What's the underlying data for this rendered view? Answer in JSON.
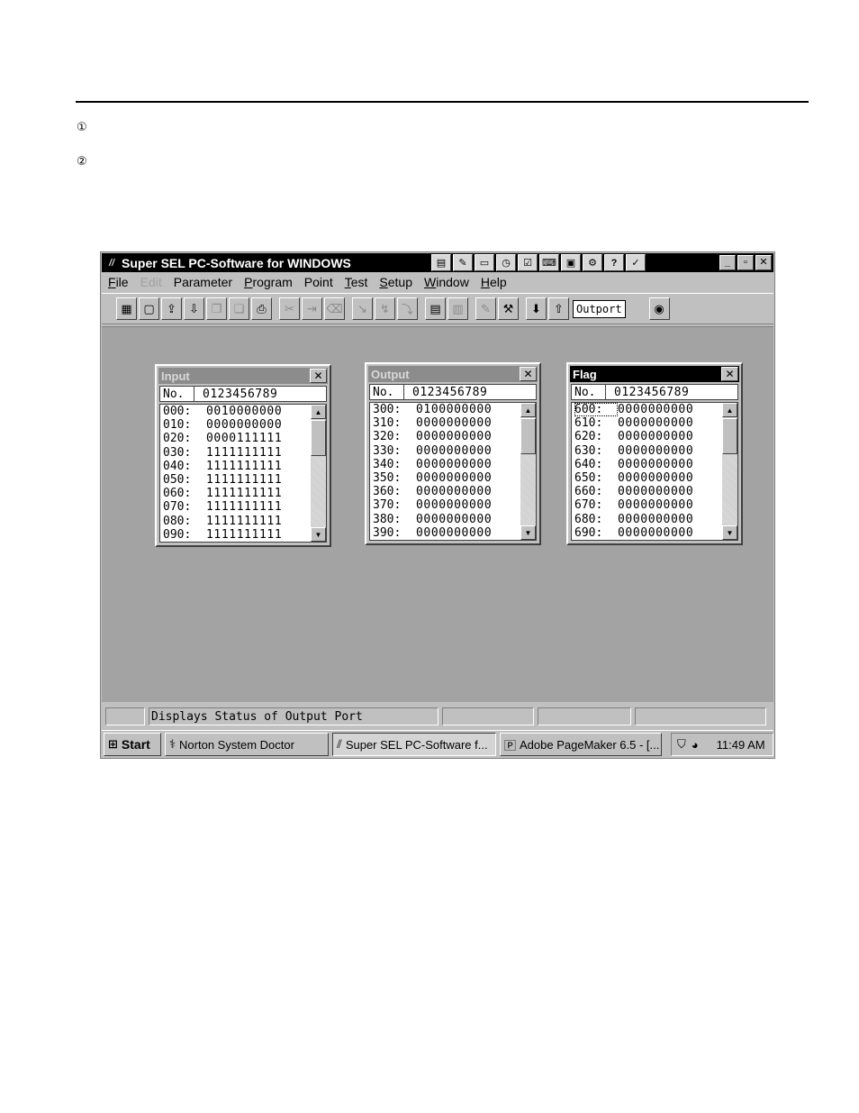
{
  "markers": [
    "①",
    "②"
  ],
  "window": {
    "title": "Super SEL PC-Software for WINDOWS",
    "tray_icons": [
      "▤",
      "✎",
      "▭",
      "◷",
      "☑",
      "⌨",
      "▣",
      "⚙",
      "?",
      "✓"
    ],
    "controls": {
      "minimize": "_",
      "maximize": "▫",
      "close": "✕"
    }
  },
  "menu": [
    {
      "label": "File",
      "key": "F",
      "rest": "ile",
      "disabled": false
    },
    {
      "label": "Edit",
      "key": "E",
      "rest": "dit",
      "disabled": true
    },
    {
      "label": "Parameter",
      "key": "P",
      "rest": "arameter",
      "disabled": false
    },
    {
      "label": "Program",
      "key": "P",
      "rest": "rogram",
      "disabled": false
    },
    {
      "label": "Point",
      "key": "P",
      "rest": "oint",
      "disabled": false
    },
    {
      "label": "Test",
      "key": "T",
      "rest": "est",
      "disabled": false
    },
    {
      "label": "Setup",
      "key": "S",
      "rest": "etup",
      "disabled": false
    },
    {
      "label": "Window",
      "key": "W",
      "rest": "indow",
      "disabled": false
    },
    {
      "label": "Help",
      "key": "H",
      "rest": "elp",
      "disabled": false
    }
  ],
  "toolbar": {
    "tooltip": "Outport"
  },
  "panels": {
    "input": {
      "title": "Input",
      "header_no": "No.",
      "header_bits": "0123456789",
      "rows": [
        {
          "addr": "000:",
          "bits": "0010000000"
        },
        {
          "addr": "010:",
          "bits": "0000000000"
        },
        {
          "addr": "020:",
          "bits": "0000111111"
        },
        {
          "addr": "030:",
          "bits": "1111111111"
        },
        {
          "addr": "040:",
          "bits": "1111111111"
        },
        {
          "addr": "050:",
          "bits": "1111111111"
        },
        {
          "addr": "060:",
          "bits": "1111111111"
        },
        {
          "addr": "070:",
          "bits": "1111111111"
        },
        {
          "addr": "080:",
          "bits": "1111111111"
        },
        {
          "addr": "090:",
          "bits": "1111111111"
        }
      ]
    },
    "output": {
      "title": "Output",
      "header_no": "No.",
      "header_bits": "0123456789",
      "rows": [
        {
          "addr": "300:",
          "bits": "0100000000"
        },
        {
          "addr": "310:",
          "bits": "0000000000"
        },
        {
          "addr": "320:",
          "bits": "0000000000"
        },
        {
          "addr": "330:",
          "bits": "0000000000"
        },
        {
          "addr": "340:",
          "bits": "0000000000"
        },
        {
          "addr": "350:",
          "bits": "0000000000"
        },
        {
          "addr": "360:",
          "bits": "0000000000"
        },
        {
          "addr": "370:",
          "bits": "0000000000"
        },
        {
          "addr": "380:",
          "bits": "0000000000"
        },
        {
          "addr": "390:",
          "bits": "0000000000"
        }
      ]
    },
    "flag": {
      "title": "Flag",
      "header_no": "No.",
      "header_bits": "0123456789",
      "rows": [
        {
          "addr": "600:",
          "bits": "0000000000"
        },
        {
          "addr": "610:",
          "bits": "0000000000"
        },
        {
          "addr": "620:",
          "bits": "0000000000"
        },
        {
          "addr": "630:",
          "bits": "0000000000"
        },
        {
          "addr": "640:",
          "bits": "0000000000"
        },
        {
          "addr": "650:",
          "bits": "0000000000"
        },
        {
          "addr": "660:",
          "bits": "0000000000"
        },
        {
          "addr": "670:",
          "bits": "0000000000"
        },
        {
          "addr": "680:",
          "bits": "0000000000"
        },
        {
          "addr": "690:",
          "bits": "0000000000"
        }
      ]
    }
  },
  "status": {
    "message": "Displays Status of Output Port"
  },
  "taskbar": {
    "start": "Start",
    "tasks": [
      "Norton System Doctor",
      "Super SEL PC-Software f...",
      "Adobe PageMaker 6.5 - [..."
    ],
    "clock": "11:49 AM"
  }
}
